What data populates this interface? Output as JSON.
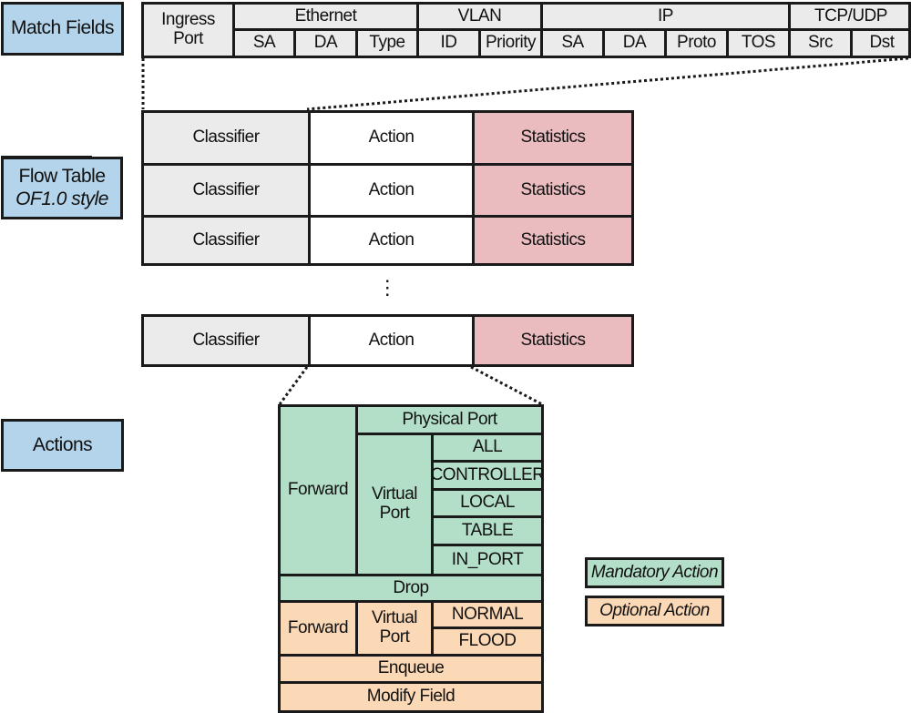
{
  "labels": {
    "match_fields": "Match Fields",
    "flow_table": "Flow Table",
    "flow_table_sub": "OF1.0 style",
    "actions": "Actions"
  },
  "match_fields": {
    "ingress_port": "Ingress Port",
    "groups": [
      {
        "name": "Ethernet",
        "fields": [
          "SA",
          "DA",
          "Type"
        ]
      },
      {
        "name": "VLAN",
        "fields": [
          "ID",
          "Priority"
        ]
      },
      {
        "name": "IP",
        "fields": [
          "SA",
          "DA",
          "Proto",
          "TOS"
        ]
      },
      {
        "name": "TCP/UDP",
        "fields": [
          "Src",
          "Dst"
        ]
      }
    ]
  },
  "flow_table": {
    "rows": [
      {
        "classifier": "Classifier",
        "action": "Action",
        "statistics": "Statistics"
      },
      {
        "classifier": "Classifier",
        "action": "Action",
        "statistics": "Statistics"
      },
      {
        "classifier": "Classifier",
        "action": "Action",
        "statistics": "Statistics"
      },
      {
        "classifier": "Classifier",
        "action": "Action",
        "statistics": "Statistics"
      }
    ],
    "ellipsis": "⋮"
  },
  "actions": {
    "mandatory": {
      "forward": "Forward",
      "physical_port": "Physical Port",
      "virtual_port": "Virtual Port",
      "virtual_ports": [
        "ALL",
        "CONTROLLER",
        "LOCAL",
        "TABLE",
        "IN_PORT"
      ],
      "drop": "Drop"
    },
    "optional": {
      "forward": "Forward",
      "virtual_port": "Virtual Port",
      "virtual_ports": [
        "NORMAL",
        "FLOOD"
      ],
      "enqueue": "Enqueue",
      "modify_field": "Modify Field"
    }
  },
  "legend": {
    "mandatory": "Mandatory Action",
    "optional": "Optional Action"
  },
  "colors": {
    "label": "#b3d4ea",
    "classifier": "#ebebeb",
    "statistics": "#ebbcbf",
    "mandatory": "#b3dfc8",
    "optional": "#fcd9b6"
  }
}
